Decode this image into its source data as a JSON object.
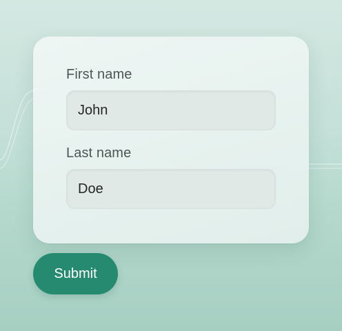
{
  "form": {
    "first_name": {
      "label": "First name",
      "value": "John"
    },
    "last_name": {
      "label": "Last name",
      "value": "Doe"
    },
    "submit_label": "Submit"
  },
  "colors": {
    "accent": "#268a71",
    "background": "#c4e0d8",
    "card": "#edf5f3",
    "input_fill": "#e1e9e7"
  }
}
